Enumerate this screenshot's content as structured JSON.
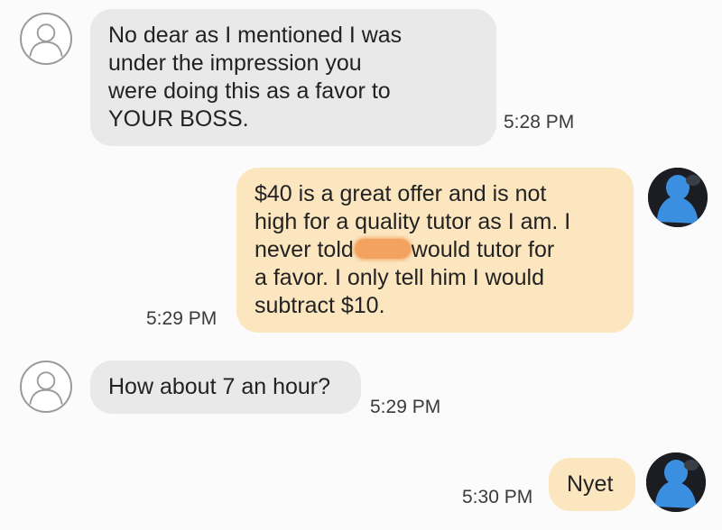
{
  "conversation": {
    "messages": [
      {
        "direction": "incoming",
        "lines": [
          "No dear as I mentioned I was",
          "under the impression you",
          "were doing this as a favor to",
          "YOUR BOSS."
        ],
        "time": "5:28 PM"
      },
      {
        "direction": "outgoing",
        "lines": [
          "$40 is a great offer and is not",
          "high for a quality tutor as I am.  I",
          "never told",
          "would tutor for",
          "a favor. I only tell him I would",
          "subtract $10."
        ],
        "time": "5:29 PM"
      },
      {
        "direction": "incoming",
        "lines": [
          "How about 7 an hour?"
        ],
        "time": "5:29 PM"
      },
      {
        "direction": "outgoing",
        "lines": [
          "Nyet"
        ],
        "time": "5:30 PM"
      }
    ]
  },
  "colors": {
    "incoming_bubble": "#e9e9ea",
    "outgoing_bubble": "#fbe6c0",
    "redaction": "#f3a35f",
    "avatar_photo_accent": "#3b8fe0"
  },
  "icons": {
    "contact_avatar": "person-outline-icon",
    "own_avatar": "profile-photo"
  }
}
